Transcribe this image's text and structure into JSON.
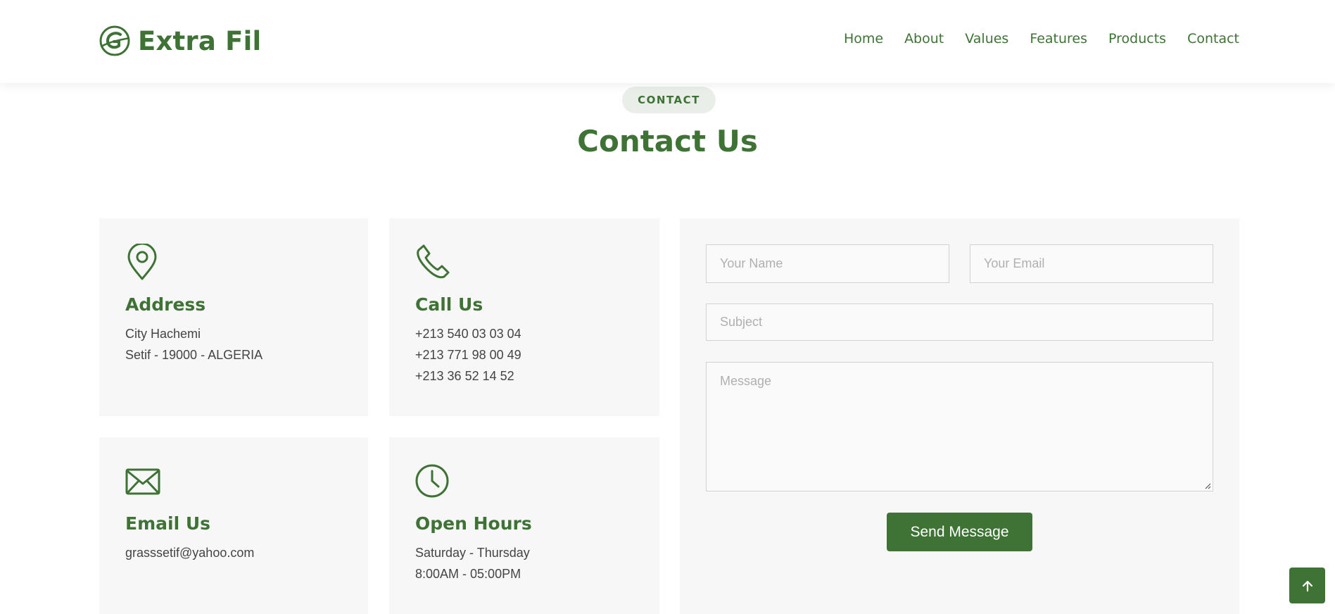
{
  "brand": {
    "name": "Extra Fil",
    "color": "#3e7335"
  },
  "nav": {
    "items": [
      {
        "label": "Home"
      },
      {
        "label": "About"
      },
      {
        "label": "Values"
      },
      {
        "label": "Features"
      },
      {
        "label": "Products"
      },
      {
        "label": "Contact"
      }
    ]
  },
  "section": {
    "tag": "CONTACT",
    "title": "Contact Us"
  },
  "cards": {
    "address": {
      "icon": "map-pin-icon",
      "title": "Address",
      "lines": [
        "City Hachemi",
        "Setif - 19000 - ALGERIA"
      ]
    },
    "call": {
      "icon": "phone-icon",
      "title": "Call Us",
      "lines": [
        "+213 540 03 03 04",
        "+213 771 98 00 49",
        "+213 36 52 14 52"
      ]
    },
    "email": {
      "icon": "envelope-icon",
      "title": "Email Us",
      "lines": [
        "grasssetif@yahoo.com"
      ]
    },
    "hours": {
      "icon": "clock-icon",
      "title": "Open Hours",
      "lines": [
        "Saturday - Thursday",
        "8:00AM - 05:00PM"
      ]
    }
  },
  "form": {
    "name_placeholder": "Your Name",
    "email_placeholder": "Your Email",
    "subject_placeholder": "Subject",
    "message_placeholder": "Message",
    "submit_label": "Send Message"
  },
  "back_to_top": {
    "icon": "arrow-up-icon"
  }
}
